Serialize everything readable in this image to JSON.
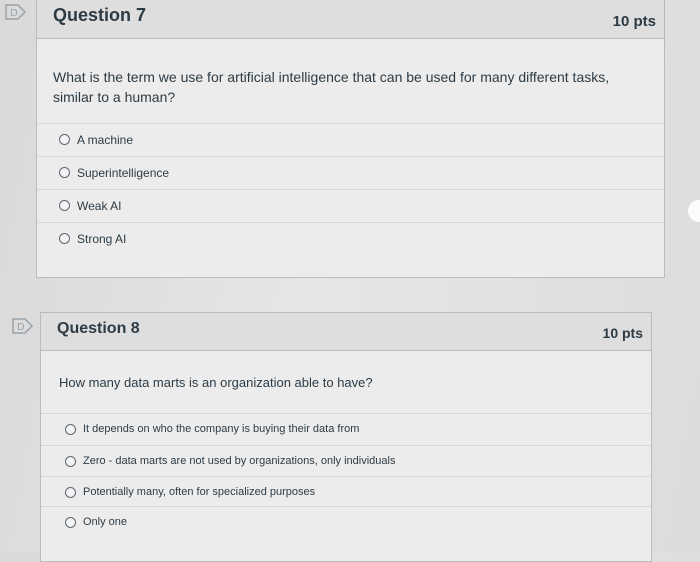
{
  "questions": [
    {
      "title": "Question 7",
      "points": "10 pts",
      "text": "What is the term we use for artificial intelligence that can be used for many different tasks, similar to a human?",
      "answers": [
        "A machine",
        "Superintelligence",
        "Weak AI",
        "Strong AI"
      ]
    },
    {
      "title": "Question 8",
      "points": "10 pts",
      "text": "How many data marts is an organization able to have?",
      "answers": [
        "It depends on who the company is buying their data from",
        "Zero - data marts are not used by organizations, only individuals",
        "Potentially many, often for specialized purposes",
        "Only one"
      ]
    }
  ]
}
